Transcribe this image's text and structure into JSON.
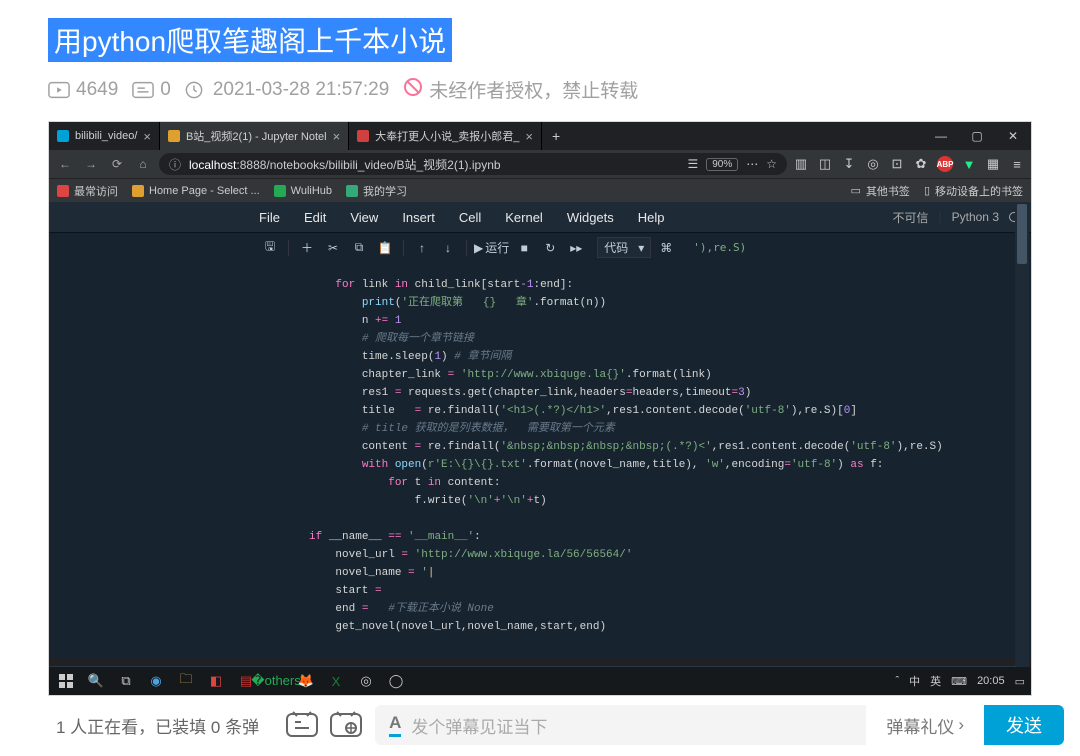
{
  "header": {
    "title": "用python爬取笔趣阁上千本小说",
    "views": "4649",
    "comments": "0",
    "date": "2021-03-28 21:57:29",
    "license": "未经作者授权，禁止转载"
  },
  "browser": {
    "tabs": [
      {
        "label": "bilibili_video/",
        "active": false
      },
      {
        "label": "B站_视频2(1) - Jupyter Notel",
        "active": true
      },
      {
        "label": "大奉打更人小说_卖报小郎君_",
        "active": false
      }
    ],
    "url_host": "localhost",
    "url_path": ":8888/notebooks/bilibili_video/B站_视频2(1).ipynb",
    "zoom": "90%",
    "bookmarks": {
      "left": [
        "最常访问",
        "Home Page - Select ...",
        "WuliHub",
        "我的学习"
      ],
      "right": [
        "其他书签",
        "移动设备上的书签"
      ]
    }
  },
  "jupyter": {
    "menu": [
      "File",
      "Edit",
      "View",
      "Insert",
      "Cell",
      "Kernel",
      "Widgets",
      "Help"
    ],
    "trusted": "不可信",
    "kernel": "Python 3",
    "run_label": "运行",
    "cell_type": "代码",
    "tool_after": "'),re.S)"
  },
  "code_lines": [
    {
      "indent": 0,
      "segs": [
        {
          "t": "for ",
          "c": "kw"
        },
        {
          "t": "link "
        },
        {
          "t": "in ",
          "c": "kw"
        },
        {
          "t": "child_link[start"
        },
        {
          "t": "-1",
          "c": "num"
        },
        {
          "t": ":end]:"
        }
      ]
    },
    {
      "indent": 1,
      "segs": [
        {
          "t": "print",
          "c": "fn"
        },
        {
          "t": "("
        },
        {
          "t": "'正在爬取第   {}   章'",
          "c": "str"
        },
        {
          "t": ".format(n))"
        }
      ]
    },
    {
      "indent": 1,
      "segs": [
        {
          "t": "n "
        },
        {
          "t": "+= ",
          "c": "kw"
        },
        {
          "t": "1",
          "c": "num"
        }
      ]
    },
    {
      "indent": 1,
      "segs": [
        {
          "t": "# 爬取每一个章节链接",
          "c": "cmt"
        }
      ]
    },
    {
      "indent": 1,
      "segs": [
        {
          "t": "time.sleep("
        },
        {
          "t": "1",
          "c": "num"
        },
        {
          "t": ") "
        },
        {
          "t": "# 章节间隔",
          "c": "cmt"
        }
      ]
    },
    {
      "indent": 1,
      "segs": [
        {
          "t": "chapter_link "
        },
        {
          "t": "= ",
          "c": "kw"
        },
        {
          "t": "'http://www.xbiquge.la{}'",
          "c": "str"
        },
        {
          "t": ".format(link)"
        }
      ]
    },
    {
      "indent": 1,
      "segs": [
        {
          "t": "res1 "
        },
        {
          "t": "= ",
          "c": "kw"
        },
        {
          "t": "requests.get(chapter_link,headers"
        },
        {
          "t": "=",
          "c": "kw"
        },
        {
          "t": "headers,timeout"
        },
        {
          "t": "=",
          "c": "kw"
        },
        {
          "t": "3",
          "c": "num"
        },
        {
          "t": ")"
        }
      ]
    },
    {
      "indent": 1,
      "segs": [
        {
          "t": "title   "
        },
        {
          "t": "= ",
          "c": "kw"
        },
        {
          "t": "re.findall("
        },
        {
          "t": "'<h1>(.*?)</h1>'",
          "c": "str"
        },
        {
          "t": ",res1.content.decode("
        },
        {
          "t": "'utf-8'",
          "c": "str"
        },
        {
          "t": "),re.S)["
        },
        {
          "t": "0",
          "c": "num"
        },
        {
          "t": "]"
        }
      ]
    },
    {
      "indent": 1,
      "segs": [
        {
          "t": "# title 获取的是列表数据，  需要取第一个元素",
          "c": "cmt"
        }
      ]
    },
    {
      "indent": 1,
      "segs": [
        {
          "t": "content "
        },
        {
          "t": "= ",
          "c": "kw"
        },
        {
          "t": "re.findall("
        },
        {
          "t": "'&nbsp;&nbsp;&nbsp;&nbsp;(.*?)<'",
          "c": "str"
        },
        {
          "t": ",res1.content.decode("
        },
        {
          "t": "'utf-8'",
          "c": "str"
        },
        {
          "t": "),re.S)"
        }
      ]
    },
    {
      "indent": 1,
      "segs": [
        {
          "t": "with ",
          "c": "kw"
        },
        {
          "t": "open",
          "c": "fn"
        },
        {
          "t": "("
        },
        {
          "t": "r'E:\\{}\\{}.txt'",
          "c": "str"
        },
        {
          "t": ".format(novel_name,title), "
        },
        {
          "t": "'w'",
          "c": "str"
        },
        {
          "t": ",encoding"
        },
        {
          "t": "=",
          "c": "kw"
        },
        {
          "t": "'utf-8'",
          "c": "str"
        },
        {
          "t": ") "
        },
        {
          "t": "as ",
          "c": "kw"
        },
        {
          "t": "f:"
        }
      ]
    },
    {
      "indent": 2,
      "segs": [
        {
          "t": "for ",
          "c": "kw"
        },
        {
          "t": "t "
        },
        {
          "t": "in ",
          "c": "kw"
        },
        {
          "t": "content:"
        }
      ]
    },
    {
      "indent": 3,
      "segs": [
        {
          "t": "f.write("
        },
        {
          "t": "'\\n'",
          "c": "str"
        },
        {
          "t": "+",
          "c": "kw"
        },
        {
          "t": "'\\n'",
          "c": "str"
        },
        {
          "t": "+",
          "c": "kw"
        },
        {
          "t": "t)"
        }
      ]
    },
    {
      "indent": -1,
      "segs": []
    },
    {
      "indent": -2,
      "segs": [
        {
          "t": "if ",
          "c": "kw"
        },
        {
          "t": "__name__ "
        },
        {
          "t": "== ",
          "c": "kw"
        },
        {
          "t": "'__main__'",
          "c": "str"
        },
        {
          "t": ":"
        }
      ]
    },
    {
      "indent": -1,
      "segs": [
        {
          "t": "novel_url "
        },
        {
          "t": "= ",
          "c": "kw"
        },
        {
          "t": "'http://www.xbiquge.la/56/56564/'",
          "c": "str"
        }
      ]
    },
    {
      "indent": -1,
      "segs": [
        {
          "t": "novel_name "
        },
        {
          "t": "= ",
          "c": "kw"
        },
        {
          "t": "'",
          "c": "str"
        },
        {
          "t": "|",
          "c": "ye"
        }
      ]
    },
    {
      "indent": -1,
      "segs": [
        {
          "t": "start "
        },
        {
          "t": "= ",
          "c": "kw"
        }
      ]
    },
    {
      "indent": -1,
      "segs": [
        {
          "t": "end "
        },
        {
          "t": "= ",
          "c": "kw"
        },
        {
          "t": "  "
        },
        {
          "t": "#下载正本小说 None",
          "c": "cmt"
        }
      ]
    },
    {
      "indent": -1,
      "segs": [
        {
          "t": "get_novel(novel_url,novel_name,start,end)"
        }
      ]
    }
  ],
  "taskbar": {
    "time": "20:05",
    "ime": "英",
    "net": "中"
  },
  "danmu": {
    "info": "1 人正在看，已装填 0 条弹",
    "placeholder": "发个弹幕见证当下",
    "etiquette": "弹幕礼仪",
    "send": "发送"
  }
}
